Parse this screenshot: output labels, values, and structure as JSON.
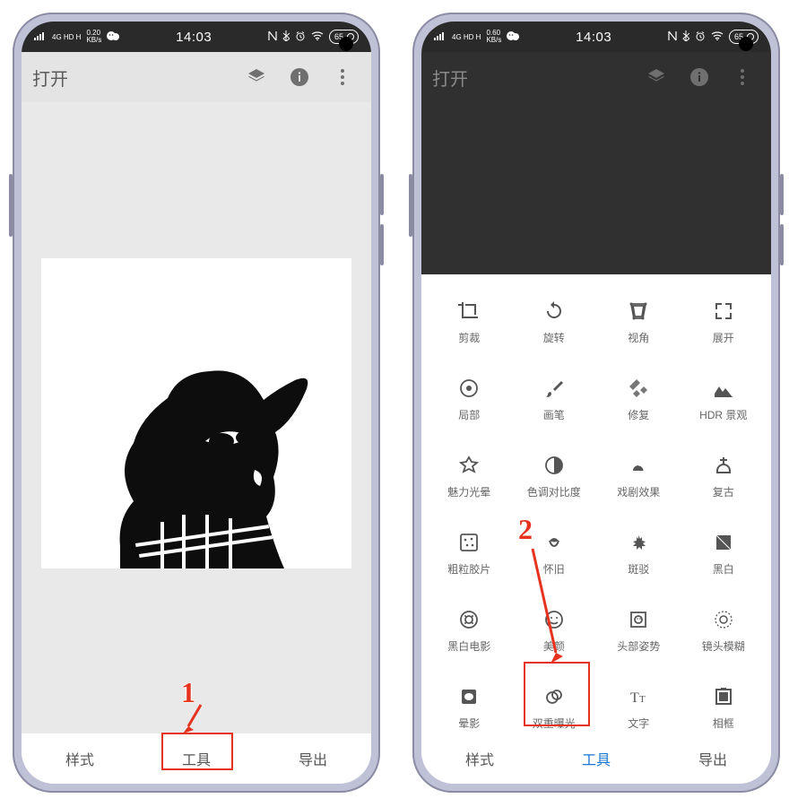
{
  "status": {
    "net": "4G HD  H",
    "kbs_left": "0.20",
    "kbs_right": "0.60",
    "kbs_unit": "KB/s",
    "time": "14:03",
    "battery": "65"
  },
  "appbar": {
    "title": "打开"
  },
  "nav": {
    "style": "样式",
    "tools": "工具",
    "export": "导出"
  },
  "tools": [
    {
      "id": "crop",
      "label": "剪裁"
    },
    {
      "id": "rotate",
      "label": "旋转"
    },
    {
      "id": "perspective",
      "label": "视角"
    },
    {
      "id": "expand",
      "label": "展开"
    },
    {
      "id": "selective",
      "label": "局部"
    },
    {
      "id": "brush",
      "label": "画笔"
    },
    {
      "id": "healing",
      "label": "修复"
    },
    {
      "id": "hdr",
      "label": "HDR 景观"
    },
    {
      "id": "glamour",
      "label": "魅力光晕"
    },
    {
      "id": "tonal",
      "label": "色调对比度"
    },
    {
      "id": "drama",
      "label": "戏剧效果"
    },
    {
      "id": "vintage",
      "label": "复古"
    },
    {
      "id": "grainy",
      "label": "粗粒胶片"
    },
    {
      "id": "retrolux",
      "label": "怀旧"
    },
    {
      "id": "grunge",
      "label": "斑驳"
    },
    {
      "id": "bw",
      "label": "黑白"
    },
    {
      "id": "noir",
      "label": "黑白电影"
    },
    {
      "id": "portrait",
      "label": "美颜"
    },
    {
      "id": "headpose",
      "label": "头部姿势"
    },
    {
      "id": "lensblur",
      "label": "镜头模糊"
    },
    {
      "id": "vignette",
      "label": "晕影"
    },
    {
      "id": "double",
      "label": "双重曝光"
    },
    {
      "id": "text",
      "label": "文字"
    },
    {
      "id": "frames",
      "label": "相框"
    }
  ],
  "annot": {
    "n1": "1",
    "n2": "2"
  }
}
